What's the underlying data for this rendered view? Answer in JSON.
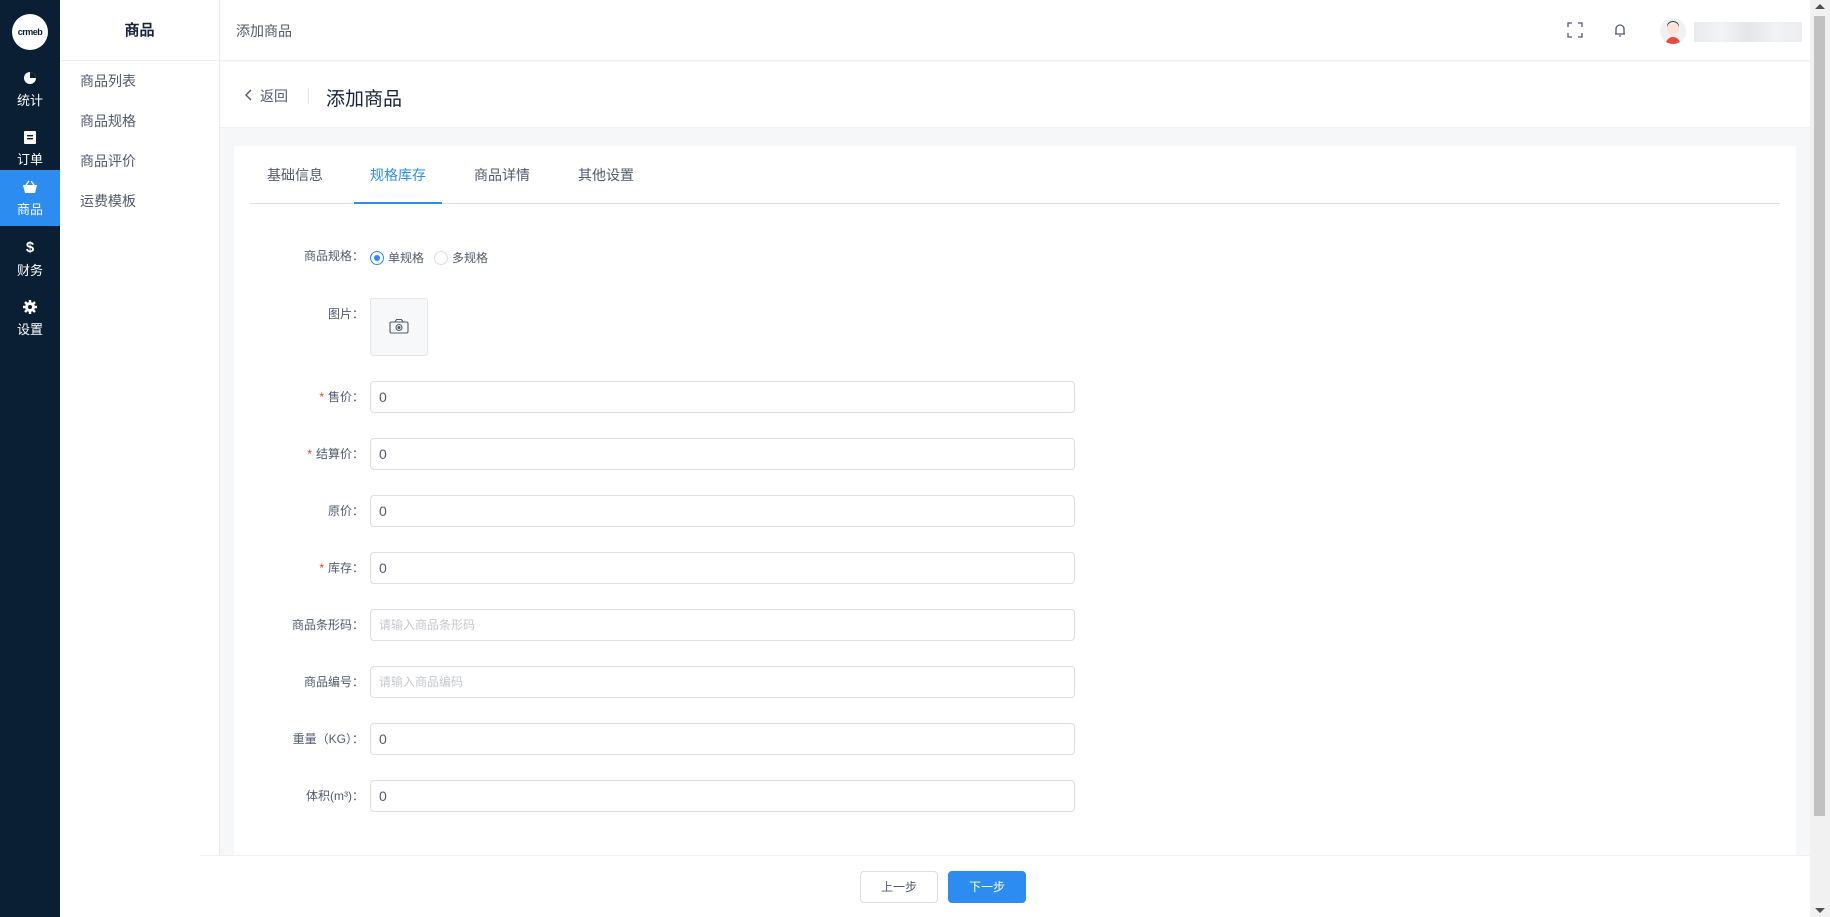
{
  "brand": {
    "logo_text": "crmeb"
  },
  "rail": [
    {
      "label": "统计",
      "icon": "pie-chart-icon"
    },
    {
      "label": "订单",
      "icon": "clipboard-icon"
    },
    {
      "label": "商品",
      "icon": "basket-icon",
      "active": true
    },
    {
      "label": "财务",
      "icon": "dollar-icon"
    },
    {
      "label": "设置",
      "icon": "gear-icon"
    }
  ],
  "submenu": {
    "title": "商品",
    "items": [
      "商品列表",
      "商品规格",
      "商品评价",
      "运费模板"
    ]
  },
  "header": {
    "breadcrumb": "添加商品"
  },
  "pagehead": {
    "back_label": "返回",
    "title": "添加商品"
  },
  "tabs": [
    "基础信息",
    "规格库存",
    "商品详情",
    "其他设置"
  ],
  "active_tab": "规格库存",
  "form": {
    "spec_label": "商品规格：",
    "spec_options": [
      "单规格",
      "多规格"
    ],
    "spec_selected": "单规格",
    "image_label": "图片：",
    "fields": [
      {
        "label": "售价：",
        "required": true,
        "value": "0",
        "placeholder": ""
      },
      {
        "label": "结算价：",
        "required": true,
        "value": "0",
        "placeholder": ""
      },
      {
        "label": "原价：",
        "required": false,
        "value": "0",
        "placeholder": ""
      },
      {
        "label": "库存：",
        "required": true,
        "value": "0",
        "placeholder": ""
      },
      {
        "label": "商品条形码：",
        "required": false,
        "value": "",
        "placeholder": "请输入商品条形码"
      },
      {
        "label": "商品编号：",
        "required": false,
        "value": "",
        "placeholder": "请输入商品编码"
      },
      {
        "label": "重量（KG）：",
        "required": false,
        "value": "0",
        "placeholder": ""
      },
      {
        "label": "体积(m³)：",
        "required": false,
        "value": "0",
        "placeholder": ""
      }
    ]
  },
  "footer": {
    "prev_label": "上一步",
    "next_label": "下一步"
  },
  "colors": {
    "primary": "#2d8cf0",
    "rail_bg": "#0a1f33",
    "required": "#ed4014"
  }
}
